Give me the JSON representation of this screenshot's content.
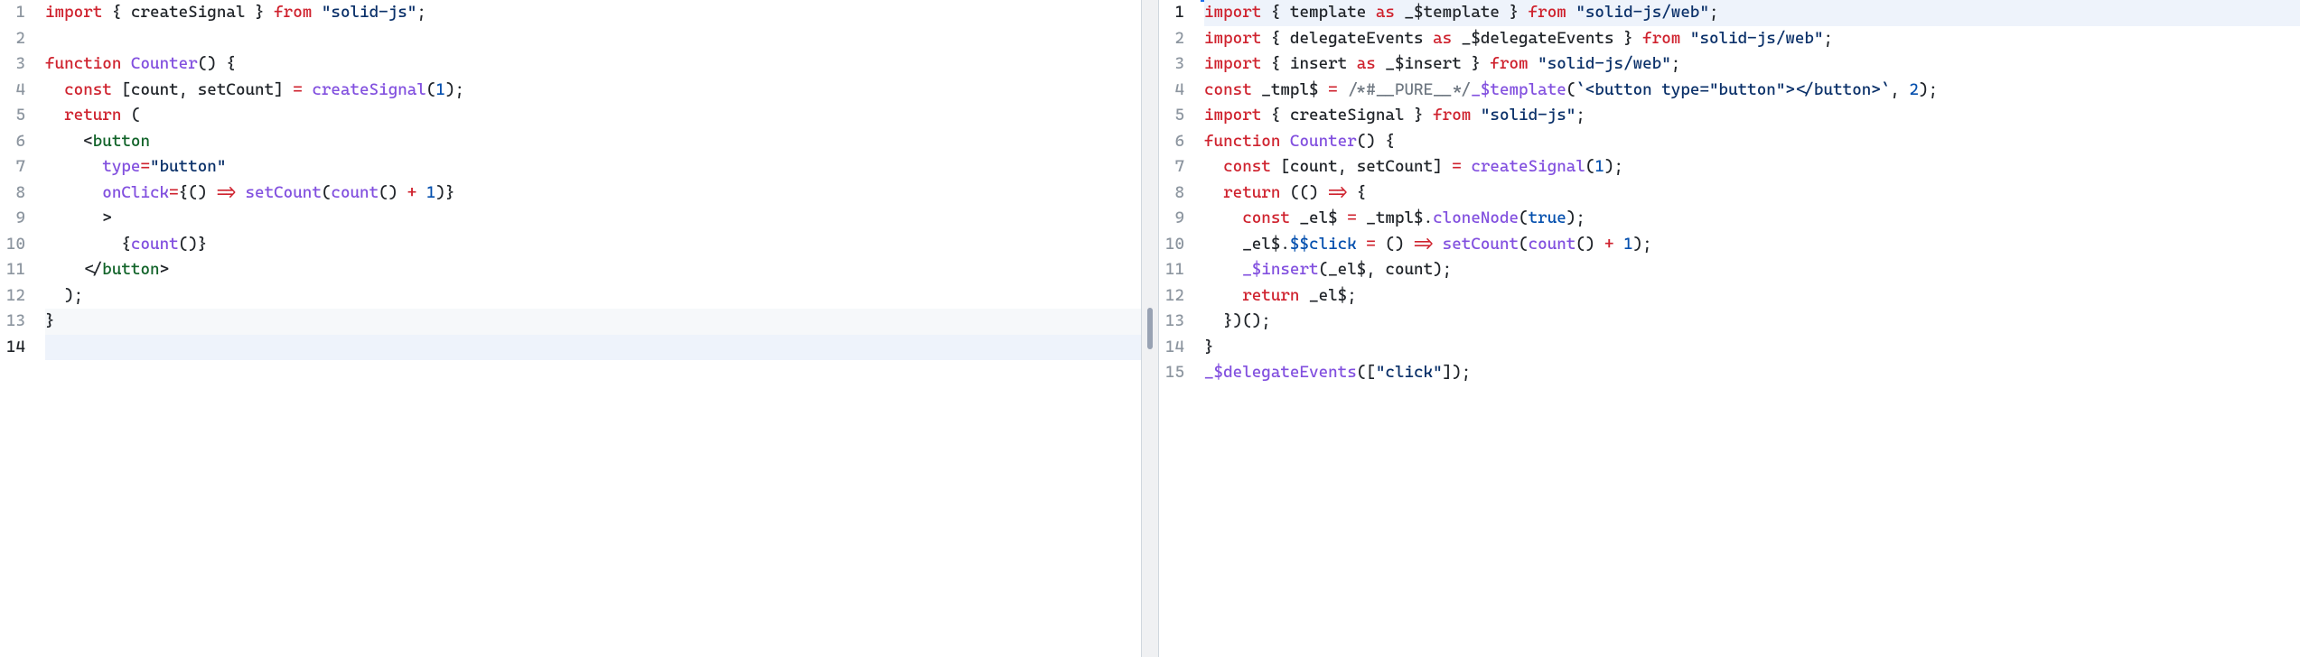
{
  "left": {
    "active_line": 14,
    "lines": [
      [
        {
          "t": "import",
          "c": "kw"
        },
        {
          "t": " { createSignal } ",
          "c": "id"
        },
        {
          "t": "from",
          "c": "kw"
        },
        {
          "t": " ",
          "c": "id"
        },
        {
          "t": "\"solid-js\"",
          "c": "str"
        },
        {
          "t": ";",
          "c": "pn"
        }
      ],
      [],
      [
        {
          "t": "function",
          "c": "kw"
        },
        {
          "t": " ",
          "c": "id"
        },
        {
          "t": "Counter",
          "c": "fn"
        },
        {
          "t": "() {",
          "c": "pn"
        }
      ],
      [
        {
          "t": "  ",
          "c": "id"
        },
        {
          "t": "const",
          "c": "kw"
        },
        {
          "t": " [count, setCount] ",
          "c": "id"
        },
        {
          "t": "=",
          "c": "op"
        },
        {
          "t": " ",
          "c": "id"
        },
        {
          "t": "createSignal",
          "c": "fn"
        },
        {
          "t": "(",
          "c": "pn"
        },
        {
          "t": "1",
          "c": "num"
        },
        {
          "t": ");",
          "c": "pn"
        }
      ],
      [
        {
          "t": "  ",
          "c": "id"
        },
        {
          "t": "return",
          "c": "kw"
        },
        {
          "t": " (",
          "c": "pn"
        }
      ],
      [
        {
          "t": "    <",
          "c": "pn"
        },
        {
          "t": "button",
          "c": "tag"
        }
      ],
      [
        {
          "t": "      ",
          "c": "id"
        },
        {
          "t": "type",
          "c": "fn"
        },
        {
          "t": "=",
          "c": "op"
        },
        {
          "t": "\"button\"",
          "c": "str"
        }
      ],
      [
        {
          "t": "      ",
          "c": "id"
        },
        {
          "t": "onClick",
          "c": "fn"
        },
        {
          "t": "=",
          "c": "op"
        },
        {
          "t": "{",
          "c": "pn"
        },
        {
          "t": "() ",
          "c": "id"
        },
        {
          "t": "=>",
          "c": "op"
        },
        {
          "t": " ",
          "c": "id"
        },
        {
          "t": "setCount",
          "c": "fn"
        },
        {
          "t": "(",
          "c": "pn"
        },
        {
          "t": "count",
          "c": "fn"
        },
        {
          "t": "() ",
          "c": "pn"
        },
        {
          "t": "+",
          "c": "op"
        },
        {
          "t": " ",
          "c": "id"
        },
        {
          "t": "1",
          "c": "num"
        },
        {
          "t": ")}",
          "c": "pn"
        }
      ],
      [
        {
          "t": "      >",
          "c": "pn"
        }
      ],
      [
        {
          "t": "        {",
          "c": "pn"
        },
        {
          "t": "count",
          "c": "fn"
        },
        {
          "t": "()}",
          "c": "pn"
        }
      ],
      [
        {
          "t": "    </",
          "c": "pn"
        },
        {
          "t": "button",
          "c": "tag"
        },
        {
          "t": ">",
          "c": "pn"
        }
      ],
      [
        {
          "t": "  );",
          "c": "pn"
        }
      ],
      [
        {
          "t": "}",
          "c": "pn"
        }
      ],
      []
    ]
  },
  "right": {
    "active_line": 1,
    "lines": [
      [
        {
          "t": "import",
          "c": "kw"
        },
        {
          "t": " { template ",
          "c": "id"
        },
        {
          "t": "as",
          "c": "kw"
        },
        {
          "t": " _$template } ",
          "c": "id"
        },
        {
          "t": "from",
          "c": "kw"
        },
        {
          "t": " ",
          "c": "id"
        },
        {
          "t": "\"solid-js/web\"",
          "c": "str"
        },
        {
          "t": ";",
          "c": "pn"
        }
      ],
      [
        {
          "t": "import",
          "c": "kw"
        },
        {
          "t": " { delegateEvents ",
          "c": "id"
        },
        {
          "t": "as",
          "c": "kw"
        },
        {
          "t": " _$delegateEvents } ",
          "c": "id"
        },
        {
          "t": "from",
          "c": "kw"
        },
        {
          "t": " ",
          "c": "id"
        },
        {
          "t": "\"solid-js/web\"",
          "c": "str"
        },
        {
          "t": ";",
          "c": "pn"
        }
      ],
      [
        {
          "t": "import",
          "c": "kw"
        },
        {
          "t": " { insert ",
          "c": "id"
        },
        {
          "t": "as",
          "c": "kw"
        },
        {
          "t": " _$insert } ",
          "c": "id"
        },
        {
          "t": "from",
          "c": "kw"
        },
        {
          "t": " ",
          "c": "id"
        },
        {
          "t": "\"solid-js/web\"",
          "c": "str"
        },
        {
          "t": ";",
          "c": "pn"
        }
      ],
      [
        {
          "t": "const",
          "c": "kw"
        },
        {
          "t": " _tmpl$ ",
          "c": "id"
        },
        {
          "t": "=",
          "c": "op"
        },
        {
          "t": " ",
          "c": "id"
        },
        {
          "t": "/*#__PURE__*/",
          "c": "cmt"
        },
        {
          "t": "_$template",
          "c": "fn"
        },
        {
          "t": "(",
          "c": "pn"
        },
        {
          "t": "`<button type=\"button\"></button>`",
          "c": "str"
        },
        {
          "t": ", ",
          "c": "pn"
        },
        {
          "t": "2",
          "c": "num"
        },
        {
          "t": ");",
          "c": "pn"
        }
      ],
      [
        {
          "t": "import",
          "c": "kw"
        },
        {
          "t": " { createSignal } ",
          "c": "id"
        },
        {
          "t": "from",
          "c": "kw"
        },
        {
          "t": " ",
          "c": "id"
        },
        {
          "t": "\"solid-js\"",
          "c": "str"
        },
        {
          "t": ";",
          "c": "pn"
        }
      ],
      [
        {
          "t": "function",
          "c": "kw"
        },
        {
          "t": " ",
          "c": "id"
        },
        {
          "t": "Counter",
          "c": "fn"
        },
        {
          "t": "() {",
          "c": "pn"
        }
      ],
      [
        {
          "t": "  ",
          "c": "id"
        },
        {
          "t": "const",
          "c": "kw"
        },
        {
          "t": " [count, setCount] ",
          "c": "id"
        },
        {
          "t": "=",
          "c": "op"
        },
        {
          "t": " ",
          "c": "id"
        },
        {
          "t": "createSignal",
          "c": "fn"
        },
        {
          "t": "(",
          "c": "pn"
        },
        {
          "t": "1",
          "c": "num"
        },
        {
          "t": ");",
          "c": "pn"
        }
      ],
      [
        {
          "t": "  ",
          "c": "id"
        },
        {
          "t": "return",
          "c": "kw"
        },
        {
          "t": " (() ",
          "c": "pn"
        },
        {
          "t": "=>",
          "c": "op"
        },
        {
          "t": " {",
          "c": "pn"
        }
      ],
      [
        {
          "t": "    ",
          "c": "id"
        },
        {
          "t": "const",
          "c": "kw"
        },
        {
          "t": " _el$ ",
          "c": "id"
        },
        {
          "t": "=",
          "c": "op"
        },
        {
          "t": " _tmpl$.",
          "c": "id"
        },
        {
          "t": "cloneNode",
          "c": "fn"
        },
        {
          "t": "(",
          "c": "pn"
        },
        {
          "t": "true",
          "c": "num"
        },
        {
          "t": ");",
          "c": "pn"
        }
      ],
      [
        {
          "t": "    _el$.",
          "c": "id"
        },
        {
          "t": "$$click",
          "c": "bl"
        },
        {
          "t": " ",
          "c": "id"
        },
        {
          "t": "=",
          "c": "op"
        },
        {
          "t": " () ",
          "c": "id"
        },
        {
          "t": "=>",
          "c": "op"
        },
        {
          "t": " ",
          "c": "id"
        },
        {
          "t": "setCount",
          "c": "fn"
        },
        {
          "t": "(",
          "c": "pn"
        },
        {
          "t": "count",
          "c": "fn"
        },
        {
          "t": "() ",
          "c": "pn"
        },
        {
          "t": "+",
          "c": "op"
        },
        {
          "t": " ",
          "c": "id"
        },
        {
          "t": "1",
          "c": "num"
        },
        {
          "t": ");",
          "c": "pn"
        }
      ],
      [
        {
          "t": "    ",
          "c": "id"
        },
        {
          "t": "_$insert",
          "c": "fn"
        },
        {
          "t": "(_el$, count);",
          "c": "pn"
        }
      ],
      [
        {
          "t": "    ",
          "c": "id"
        },
        {
          "t": "return",
          "c": "kw"
        },
        {
          "t": " _el$;",
          "c": "pn"
        }
      ],
      [
        {
          "t": "  })();",
          "c": "pn"
        }
      ],
      [
        {
          "t": "}",
          "c": "pn"
        }
      ],
      [
        {
          "t": "_$delegateEvents",
          "c": "fn"
        },
        {
          "t": "([",
          "c": "pn"
        },
        {
          "t": "\"click\"",
          "c": "str"
        },
        {
          "t": "]);",
          "c": "pn"
        }
      ]
    ]
  }
}
